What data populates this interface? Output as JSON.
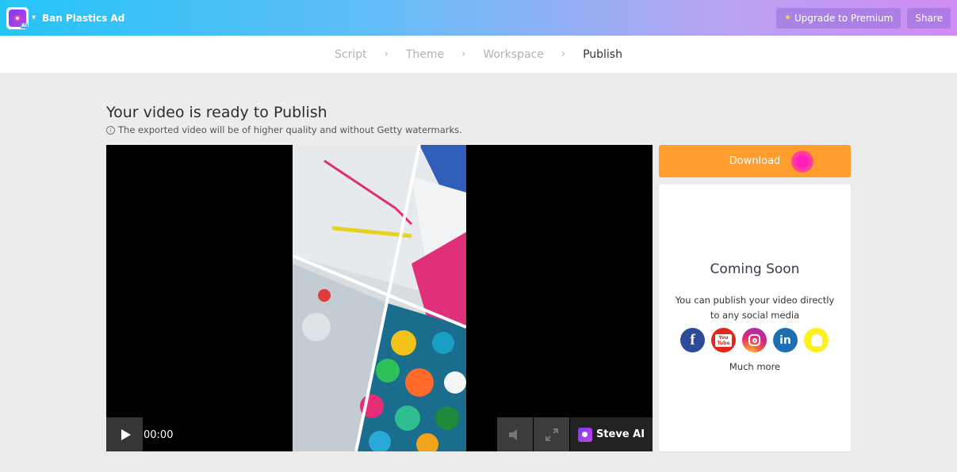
{
  "topbar": {
    "project_name": "Ban Plastics Ad",
    "upgrade_label": "Upgrade to Premium",
    "share_label": "Share",
    "logo_badge": "AI"
  },
  "steps": [
    {
      "label": "Script",
      "active": false
    },
    {
      "label": "Theme",
      "active": false
    },
    {
      "label": "Workspace",
      "active": false
    },
    {
      "label": "Publish",
      "active": true
    }
  ],
  "main": {
    "heading": "Your video is ready to Publish",
    "note": "The exported video will be of higher quality and without Getty watermarks."
  },
  "player": {
    "time": "00:00",
    "brand_label": "Steve AI"
  },
  "panel": {
    "download_label": "Download",
    "title": "Coming Soon",
    "text_line1": "You can publish your video directly",
    "text_line2": "to any social media",
    "more_label": "Much more",
    "social": [
      "facebook-icon",
      "youtube-icon",
      "instagram-icon",
      "linkedin-icon",
      "snapchat-icon"
    ]
  },
  "colors": {
    "accent_orange": "#ff9d2e",
    "cursor_pink": "#ff1dc0"
  }
}
